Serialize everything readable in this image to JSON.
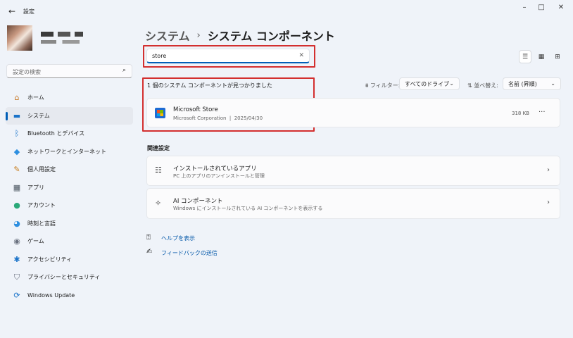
{
  "app": {
    "back_icon": "back-arrow-icon",
    "title": "設定"
  },
  "window_controls": {
    "minimize": "–",
    "maximize": "□",
    "close": "✕"
  },
  "sidebar": {
    "search_placeholder": "設定の検索",
    "items": [
      {
        "label": "ホーム",
        "icon": "home-icon",
        "glyph": "⌂",
        "color": "#c87a2a"
      },
      {
        "label": "システム",
        "icon": "system-icon",
        "glyph": "▬",
        "color": "#1a73c9",
        "active": true
      },
      {
        "label": "Bluetooth とデバイス",
        "icon": "bluetooth-icon",
        "glyph": "ᛒ",
        "color": "#1a73c9"
      },
      {
        "label": "ネットワークとインターネット",
        "icon": "network-icon",
        "glyph": "◆",
        "color": "#2e8fe0"
      },
      {
        "label": "個人用設定",
        "icon": "brush-icon",
        "glyph": "✎",
        "color": "#c77b1a"
      },
      {
        "label": "アプリ",
        "icon": "apps-icon",
        "glyph": "▦",
        "color": "#4a5560"
      },
      {
        "label": "アカウント",
        "icon": "account-icon",
        "glyph": "●",
        "color": "#2aa879"
      },
      {
        "label": "時刻と言語",
        "icon": "globe-clock-icon",
        "glyph": "◕",
        "color": "#2e8fe0"
      },
      {
        "label": "ゲーム",
        "icon": "gamepad-icon",
        "glyph": "◉",
        "color": "#6b7280"
      },
      {
        "label": "アクセシビリティ",
        "icon": "accessibility-icon",
        "glyph": "✱",
        "color": "#1a73c9"
      },
      {
        "label": "プライバシーとセキュリティ",
        "icon": "shield-icon",
        "glyph": "⛉",
        "color": "#6b7280"
      },
      {
        "label": "Windows Update",
        "icon": "windows-update-icon",
        "glyph": "⟳",
        "color": "#1a73c9"
      }
    ]
  },
  "header": {
    "crumb1": "システム",
    "sep": "›",
    "crumb2": "システム コンポーネント"
  },
  "component_search": {
    "value": "store",
    "clear": "✕"
  },
  "result_text": "1 個のシステム コンポーネントが見つかりました",
  "filter": {
    "label": "フィルター:",
    "value": "すべてのドライブ",
    "chevron": "⌄"
  },
  "sort": {
    "label": "並べ替え:",
    "value": "名前 (昇順)",
    "chevron": "⌄"
  },
  "components": [
    {
      "name": "Microsoft Store",
      "publisher": "Microsoft Corporation",
      "sep": "|",
      "date": "2025/04/30",
      "size": "318 KB",
      "more": "···"
    }
  ],
  "related": {
    "title": "関連設定",
    "items": [
      {
        "title": "インストールされているアプリ",
        "desc": "PC 上のアプリのアンインストールと管理",
        "glyph": "☷"
      },
      {
        "title": "AI コンポーネント",
        "desc": "Windows にインストールされている AI コンポーネントを表示する",
        "glyph": "✧"
      }
    ]
  },
  "links": {
    "help": "ヘルプを表示",
    "feedback": "フィードバックの送信"
  }
}
